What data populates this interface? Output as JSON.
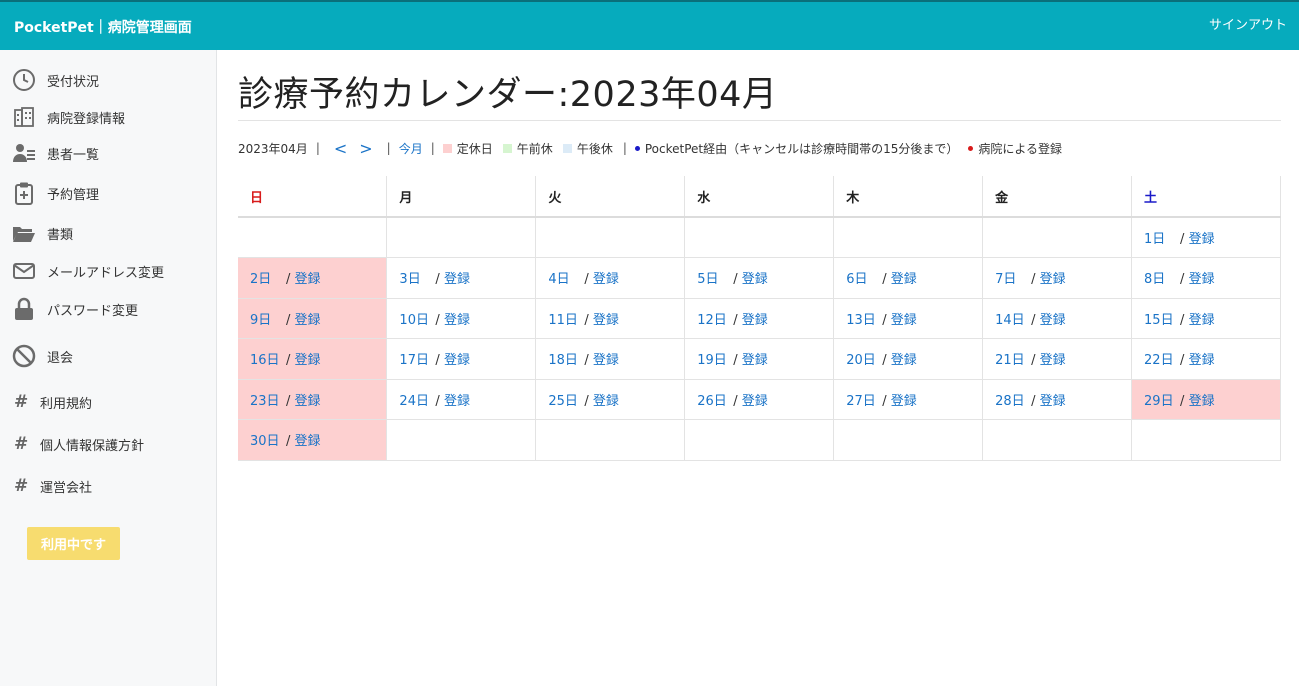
{
  "header": {
    "brand": "PocketPet｜病院管理画面",
    "signout": "サインアウト"
  },
  "sidebar": {
    "items": [
      {
        "label": "受付状況"
      },
      {
        "label": "病院登録情報"
      },
      {
        "label": "患者一覧"
      },
      {
        "label": "予約管理"
      },
      {
        "label": "書類"
      },
      {
        "label": "メールアドレス変更"
      },
      {
        "label": "パスワード変更"
      },
      {
        "label": "退会"
      }
    ],
    "links": [
      {
        "label": "利用規約"
      },
      {
        "label": "個人情報保護方針"
      },
      {
        "label": "運営会社"
      }
    ],
    "badge": "利用中です"
  },
  "main": {
    "title": "診療予約カレンダー:2023年04月",
    "legend": {
      "month": "2023年04月",
      "prev": "<",
      "next": ">",
      "this_month": "今月",
      "closed": "定休日",
      "am_off": "午前休",
      "pm_off": "午後休",
      "pocketpet": "PocketPet経由（キャンセルは診療時間帯の15分後まで）",
      "hospital": "病院による登録",
      "colors": {
        "closed": "#fdd0d0",
        "am_off": "#d6f5d0",
        "pm_off": "#dcebf7",
        "pocketpet": "#1a1ac8",
        "hospital": "#d81b1b"
      }
    },
    "calendar": {
      "weekdays": [
        "日",
        "月",
        "火",
        "水",
        "木",
        "金",
        "土"
      ],
      "register_label": "登録",
      "separator": "/",
      "weeks": [
        [
          null,
          null,
          null,
          null,
          null,
          null,
          {
            "day": "1日"
          }
        ],
        [
          {
            "day": "2日",
            "closed": true
          },
          {
            "day": "3日"
          },
          {
            "day": "4日"
          },
          {
            "day": "5日"
          },
          {
            "day": "6日"
          },
          {
            "day": "7日"
          },
          {
            "day": "8日"
          }
        ],
        [
          {
            "day": "9日",
            "closed": true
          },
          {
            "day": "10日"
          },
          {
            "day": "11日"
          },
          {
            "day": "12日"
          },
          {
            "day": "13日"
          },
          {
            "day": "14日"
          },
          {
            "day": "15日"
          }
        ],
        [
          {
            "day": "16日",
            "closed": true
          },
          {
            "day": "17日"
          },
          {
            "day": "18日"
          },
          {
            "day": "19日"
          },
          {
            "day": "20日"
          },
          {
            "day": "21日"
          },
          {
            "day": "22日"
          }
        ],
        [
          {
            "day": "23日",
            "closed": true
          },
          {
            "day": "24日"
          },
          {
            "day": "25日"
          },
          {
            "day": "26日"
          },
          {
            "day": "27日"
          },
          {
            "day": "28日"
          },
          {
            "day": "29日",
            "closed": true
          }
        ],
        [
          {
            "day": "30日",
            "closed": true
          },
          null,
          null,
          null,
          null,
          null,
          null
        ]
      ]
    }
  }
}
